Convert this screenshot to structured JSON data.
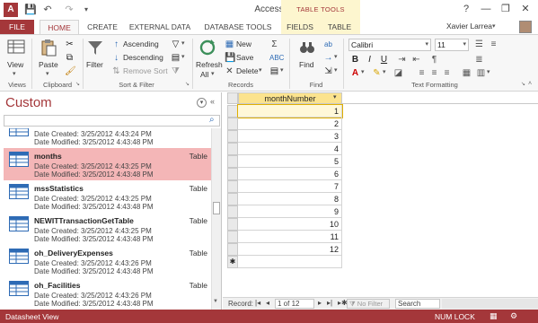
{
  "window": {
    "title": "Access"
  },
  "title_controls": {
    "help": "?",
    "minimize": "—",
    "restore": "❐",
    "close": "✕"
  },
  "tabs": {
    "file": "FILE",
    "home": "HOME",
    "create": "CREATE",
    "external": "EXTERNAL DATA",
    "dbtools": "DATABASE TOOLS",
    "fields": "FIELDS",
    "table": "TABLE"
  },
  "contextual": {
    "label": "TABLE TOOLS"
  },
  "user": {
    "name": "Xavier Larrea"
  },
  "ribbon": {
    "views": {
      "view": "View",
      "group": "Views"
    },
    "clipboard": {
      "paste": "Paste",
      "group": "Clipboard"
    },
    "sort": {
      "filter": "Filter",
      "ascending": "Ascending",
      "descending": "Descending",
      "remove_sort": "Remove Sort",
      "group": "Sort & Filter"
    },
    "records": {
      "refresh": "Refresh",
      "all": "All",
      "new": "New",
      "save": "Save",
      "delete": "Delete",
      "group": "Records"
    },
    "find": {
      "find": "Find",
      "group": "Find"
    },
    "text": {
      "font": "Calibri",
      "size": "11",
      "group": "Text Formatting",
      "bold": "B",
      "italic": "I",
      "underline": "U"
    }
  },
  "nav": {
    "title": "Custom",
    "partial_item": {
      "created": "Date Created: 3/25/2012 4:43:24 PM",
      "modified": "Date Modified: 3/25/2012 4:43:48 PM"
    },
    "items": [
      {
        "name": "months",
        "kind": "Table",
        "created": "Date Created: 3/25/2012 4:43:25 PM",
        "modified": "Date Modified: 3/25/2012 4:43:48 PM"
      },
      {
        "name": "mssStatistics",
        "kind": "Table",
        "created": "Date Created: 3/25/2012 4:43:25 PM",
        "modified": "Date Modified: 3/25/2012 4:43:48 PM"
      },
      {
        "name": "NEWITTransactionGetTable",
        "kind": "Table",
        "created": "Date Created: 3/25/2012 4:43:25 PM",
        "modified": "Date Modified: 3/25/2012 4:43:48 PM"
      },
      {
        "name": "oh_DeliveryExpenses",
        "kind": "Table",
        "created": "Date Created: 3/25/2012 4:43:26 PM",
        "modified": "Date Modified: 3/25/2012 4:43:48 PM"
      },
      {
        "name": "oh_Facilities",
        "kind": "Table",
        "created": "Date Created: 3/25/2012 4:43:26 PM",
        "modified": "Date Modified: 3/25/2012 4:43:48 PM"
      }
    ]
  },
  "datasheet": {
    "column": "monthNumber",
    "rows": [
      "1",
      "2",
      "3",
      "4",
      "5",
      "6",
      "7",
      "8",
      "9",
      "10",
      "11",
      "12"
    ],
    "new_row_marker": "✱"
  },
  "record_nav": {
    "label": "Record:",
    "position": "1 of 12",
    "filter": "No Filter",
    "search": "Search"
  },
  "status": {
    "left": "Datasheet View",
    "numlock": "NUM LOCK"
  },
  "colors": {
    "accent": "#a4373a",
    "header_highlight": "#fbe38e",
    "selected_nav": "#f4b6b7"
  }
}
